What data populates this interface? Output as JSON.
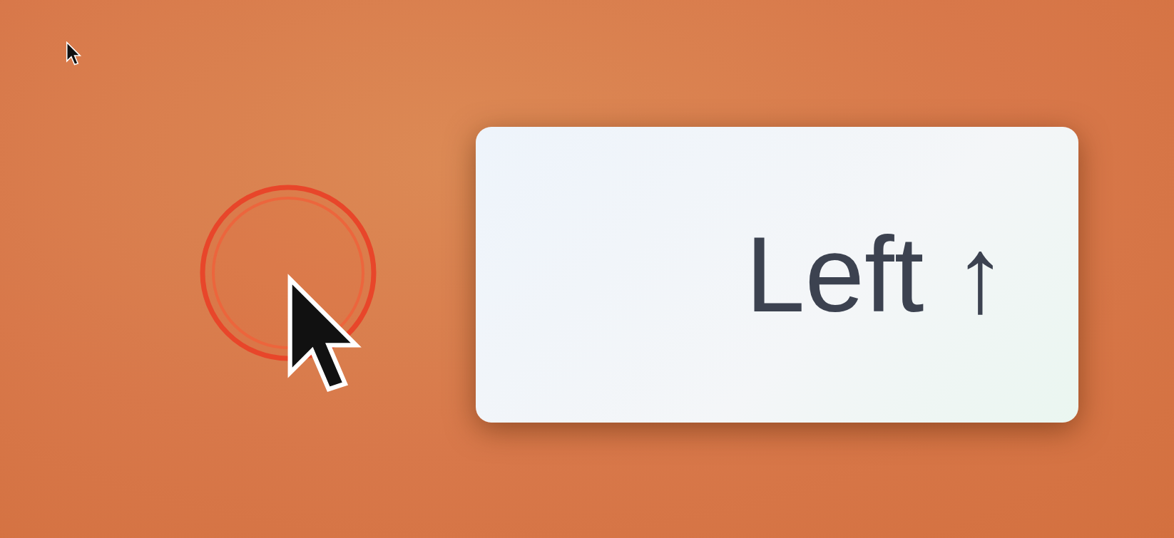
{
  "key_badge": {
    "label": "Left ↑"
  }
}
